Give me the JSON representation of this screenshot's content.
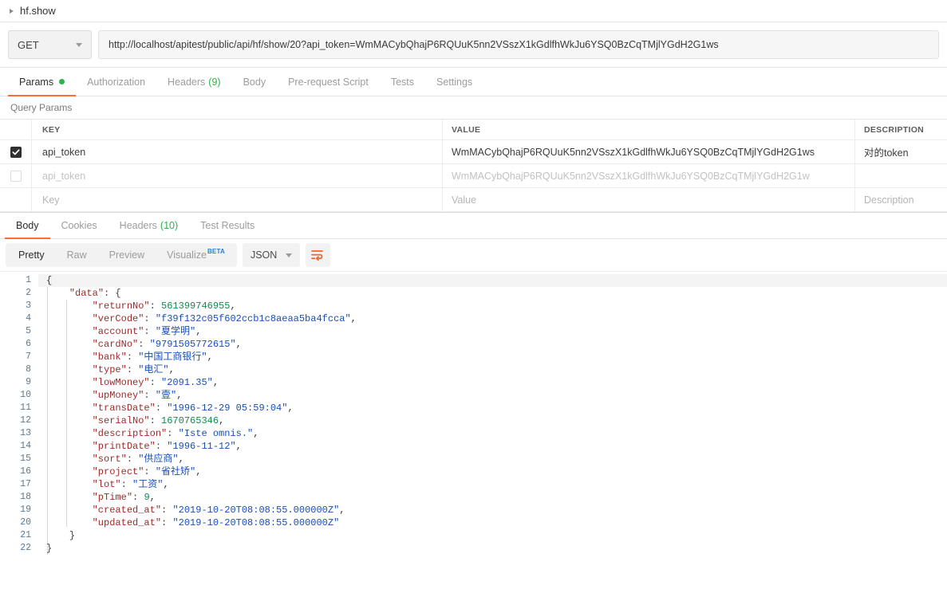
{
  "request_name": {
    "label": "hf.show",
    "caret_icon": "caret-right-icon"
  },
  "url_bar": {
    "method": "GET",
    "method_caret_icon": "chevron-down-icon",
    "url": "http://localhost/apitest/public/api/hf/show/20?api_token=WmMACybQhajP6RQUuK5nn2VSszX1kGdlfhWkJu6YSQ0BzCqTMjlYGdH2G1ws"
  },
  "request_tabs": [
    {
      "label": "Params",
      "active": true,
      "dot": true
    },
    {
      "label": "Authorization",
      "active": false
    },
    {
      "label": "Headers",
      "count": "(9)",
      "active": false
    },
    {
      "label": "Body",
      "active": false
    },
    {
      "label": "Pre-request Script",
      "active": false
    },
    {
      "label": "Tests",
      "active": false
    },
    {
      "label": "Settings",
      "active": false
    }
  ],
  "query_params": {
    "section_title": "Query Params",
    "columns": {
      "key": "KEY",
      "value": "VALUE",
      "description": "DESCRIPTION"
    },
    "rows": [
      {
        "checked": true,
        "key": "api_token",
        "value": "WmMACybQhajP6RQUuK5nn2VSszX1kGdlfhWkJu6YSQ0BzCqTMjlYGdH2G1ws",
        "description": "对的token"
      },
      {
        "checked": false,
        "key": "api_token",
        "value": "WmMACybQhajP6RQUuK5nn2VSszX1kGdlfhWkJu6YSQ0BzCqTMjlYGdH2G1w",
        "description": ""
      },
      {
        "checked": false,
        "key": "Key",
        "value": "Value",
        "description": "Description",
        "placeholder_row": true
      }
    ]
  },
  "response_tabs": [
    {
      "label": "Body",
      "active": true
    },
    {
      "label": "Cookies",
      "active": false
    },
    {
      "label": "Headers",
      "count": "(10)",
      "active": false
    },
    {
      "label": "Test Results",
      "active": false
    }
  ],
  "response_toolbar": {
    "views": [
      {
        "label": "Pretty",
        "active": true
      },
      {
        "label": "Raw",
        "active": false
      },
      {
        "label": "Preview",
        "active": false
      },
      {
        "label": "Visualize",
        "active": false,
        "badge": "BETA"
      }
    ],
    "format": "JSON",
    "format_caret_icon": "chevron-down-icon",
    "wrap_icon": "word-wrap-icon",
    "accent_color": "#ff6c37",
    "beta_color": "#2b7fd4"
  },
  "response_body": {
    "lines": [
      {
        "n": 1,
        "indent": 0,
        "tokens": [
          {
            "t": "punc",
            "v": "{"
          }
        ]
      },
      {
        "n": 2,
        "indent": 1,
        "tokens": [
          {
            "t": "key",
            "v": "\"data\""
          },
          {
            "t": "punc",
            "v": ": {"
          }
        ]
      },
      {
        "n": 3,
        "indent": 2,
        "tokens": [
          {
            "t": "key",
            "v": "\"returnNo\""
          },
          {
            "t": "punc",
            "v": ": "
          },
          {
            "t": "num",
            "v": "561399746955"
          },
          {
            "t": "punc",
            "v": ","
          }
        ]
      },
      {
        "n": 4,
        "indent": 2,
        "tokens": [
          {
            "t": "key",
            "v": "\"verCode\""
          },
          {
            "t": "punc",
            "v": ": "
          },
          {
            "t": "str",
            "v": "\"f39f132c05f602ccb1c8aeaa5ba4fcca\""
          },
          {
            "t": "punc",
            "v": ","
          }
        ]
      },
      {
        "n": 5,
        "indent": 2,
        "tokens": [
          {
            "t": "key",
            "v": "\"account\""
          },
          {
            "t": "punc",
            "v": ": "
          },
          {
            "t": "str",
            "v": "\"夏学明\""
          },
          {
            "t": "punc",
            "v": ","
          }
        ]
      },
      {
        "n": 6,
        "indent": 2,
        "tokens": [
          {
            "t": "key",
            "v": "\"cardNo\""
          },
          {
            "t": "punc",
            "v": ": "
          },
          {
            "t": "str",
            "v": "\"9791505772615\""
          },
          {
            "t": "punc",
            "v": ","
          }
        ]
      },
      {
        "n": 7,
        "indent": 2,
        "tokens": [
          {
            "t": "key",
            "v": "\"bank\""
          },
          {
            "t": "punc",
            "v": ": "
          },
          {
            "t": "str",
            "v": "\"中国工商银行\""
          },
          {
            "t": "punc",
            "v": ","
          }
        ]
      },
      {
        "n": 8,
        "indent": 2,
        "tokens": [
          {
            "t": "key",
            "v": "\"type\""
          },
          {
            "t": "punc",
            "v": ": "
          },
          {
            "t": "str",
            "v": "\"电汇\""
          },
          {
            "t": "punc",
            "v": ","
          }
        ]
      },
      {
        "n": 9,
        "indent": 2,
        "tokens": [
          {
            "t": "key",
            "v": "\"lowMoney\""
          },
          {
            "t": "punc",
            "v": ": "
          },
          {
            "t": "str",
            "v": "\"2091.35\""
          },
          {
            "t": "punc",
            "v": ","
          }
        ]
      },
      {
        "n": 10,
        "indent": 2,
        "tokens": [
          {
            "t": "key",
            "v": "\"upMoney\""
          },
          {
            "t": "punc",
            "v": ": "
          },
          {
            "t": "str",
            "v": "\"壹\""
          },
          {
            "t": "punc",
            "v": ","
          }
        ]
      },
      {
        "n": 11,
        "indent": 2,
        "tokens": [
          {
            "t": "key",
            "v": "\"transDate\""
          },
          {
            "t": "punc",
            "v": ": "
          },
          {
            "t": "str",
            "v": "\"1996-12-29 05:59:04\""
          },
          {
            "t": "punc",
            "v": ","
          }
        ]
      },
      {
        "n": 12,
        "indent": 2,
        "tokens": [
          {
            "t": "key",
            "v": "\"serialNo\""
          },
          {
            "t": "punc",
            "v": ": "
          },
          {
            "t": "num",
            "v": "1670765346"
          },
          {
            "t": "punc",
            "v": ","
          }
        ]
      },
      {
        "n": 13,
        "indent": 2,
        "tokens": [
          {
            "t": "key",
            "v": "\"description\""
          },
          {
            "t": "punc",
            "v": ": "
          },
          {
            "t": "str",
            "v": "\"Iste omnis.\""
          },
          {
            "t": "punc",
            "v": ","
          }
        ]
      },
      {
        "n": 14,
        "indent": 2,
        "tokens": [
          {
            "t": "key",
            "v": "\"printDate\""
          },
          {
            "t": "punc",
            "v": ": "
          },
          {
            "t": "str",
            "v": "\"1996-11-12\""
          },
          {
            "t": "punc",
            "v": ","
          }
        ]
      },
      {
        "n": 15,
        "indent": 2,
        "tokens": [
          {
            "t": "key",
            "v": "\"sort\""
          },
          {
            "t": "punc",
            "v": ": "
          },
          {
            "t": "str",
            "v": "\"供应商\""
          },
          {
            "t": "punc",
            "v": ","
          }
        ]
      },
      {
        "n": 16,
        "indent": 2,
        "tokens": [
          {
            "t": "key",
            "v": "\"project\""
          },
          {
            "t": "punc",
            "v": ": "
          },
          {
            "t": "str",
            "v": "\"省社矫\""
          },
          {
            "t": "punc",
            "v": ","
          }
        ]
      },
      {
        "n": 17,
        "indent": 2,
        "tokens": [
          {
            "t": "key",
            "v": "\"lot\""
          },
          {
            "t": "punc",
            "v": ": "
          },
          {
            "t": "str",
            "v": "\"工资\""
          },
          {
            "t": "punc",
            "v": ","
          }
        ]
      },
      {
        "n": 18,
        "indent": 2,
        "tokens": [
          {
            "t": "key",
            "v": "\"pTime\""
          },
          {
            "t": "punc",
            "v": ": "
          },
          {
            "t": "num",
            "v": "9"
          },
          {
            "t": "punc",
            "v": ","
          }
        ]
      },
      {
        "n": 19,
        "indent": 2,
        "tokens": [
          {
            "t": "key",
            "v": "\"created_at\""
          },
          {
            "t": "punc",
            "v": ": "
          },
          {
            "t": "str",
            "v": "\"2019-10-20T08:08:55.000000Z\""
          },
          {
            "t": "punc",
            "v": ","
          }
        ]
      },
      {
        "n": 20,
        "indent": 2,
        "tokens": [
          {
            "t": "key",
            "v": "\"updated_at\""
          },
          {
            "t": "punc",
            "v": ": "
          },
          {
            "t": "str",
            "v": "\"2019-10-20T08:08:55.000000Z\""
          }
        ]
      },
      {
        "n": 21,
        "indent": 1,
        "tokens": [
          {
            "t": "punc",
            "v": "}"
          }
        ]
      },
      {
        "n": 22,
        "indent": 0,
        "tokens": [
          {
            "t": "punc",
            "v": "}"
          }
        ]
      }
    ]
  }
}
